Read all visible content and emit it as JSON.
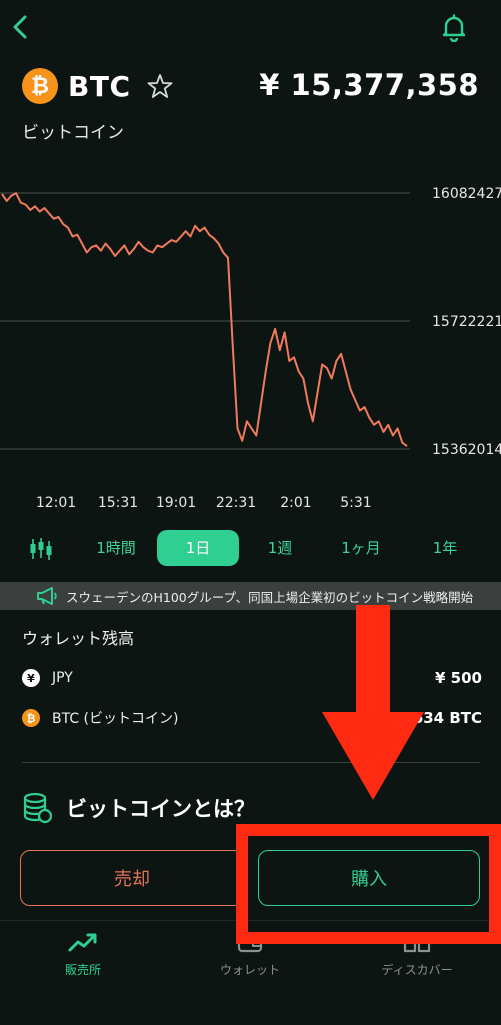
{
  "header": {
    "back_icon": "chevron-left-icon",
    "bell_icon": "bell-icon"
  },
  "coin": {
    "symbol": "BTC",
    "name": "ビットコイン",
    "price": "¥ 15,377,358",
    "logo_glyph": "₿"
  },
  "chart_data": {
    "type": "line",
    "y_ticks": [
      "16082427",
      "15722221",
      "15362014"
    ],
    "ylim": [
      15362014,
      16082427
    ],
    "x_ticks": [
      "12:01",
      "15:31",
      "19:01",
      "22:31",
      "2:01",
      "5:31"
    ],
    "line_color": "#f07a5c",
    "series": [
      {
        "values": [
          16080000,
          16060000,
          16075000,
          16082000,
          16055000,
          16050000,
          16035000,
          16045000,
          16030000,
          16040000,
          16025000,
          16010000,
          16015000,
          15995000,
          15985000,
          15960000,
          15965000,
          15940000,
          15915000,
          15930000,
          15935000,
          15920000,
          15940000,
          15925000,
          15905000,
          15920000,
          15935000,
          15910000,
          15925000,
          15945000,
          15930000,
          15920000,
          15915000,
          15935000,
          15930000,
          15940000,
          15950000,
          15945000,
          15960000,
          15975000,
          15960000,
          15990000,
          15975000,
          15985000,
          15965000,
          15955000,
          15940000,
          15915000,
          15900000,
          15650000,
          15420000,
          15385000,
          15440000,
          15420000,
          15400000,
          15490000,
          15580000,
          15660000,
          15700000,
          15640000,
          15690000,
          15610000,
          15620000,
          15580000,
          15560000,
          15490000,
          15440000,
          15520000,
          15600000,
          15590000,
          15560000,
          15610000,
          15630000,
          15580000,
          15530000,
          15500000,
          15470000,
          15480000,
          15450000,
          15430000,
          15440000,
          15410000,
          15430000,
          15400000,
          15420000,
          15380000,
          15370000
        ]
      }
    ],
    "grid": true
  },
  "ranges": {
    "candle_icon": "candlestick-icon",
    "items": [
      "1時間",
      "1日",
      "1週",
      "1ヶ月",
      "1年"
    ],
    "active": "1日"
  },
  "news": {
    "icon": "megaphone-icon",
    "text": "スウェーデンのH100グループ、同国上場企業初のビットコイン戦略開始"
  },
  "wallet": {
    "title": "ウォレット残高",
    "rows": [
      {
        "icon_glyph": "¥",
        "label": "JPY",
        "value": "¥ 500"
      },
      {
        "icon_glyph": "₿",
        "label": "BTC (ビットコイン)",
        "value": "634 BTC"
      }
    ]
  },
  "about": {
    "icon": "database-icon",
    "label": "ビットコインとは？"
  },
  "actions": {
    "sell": "売却",
    "buy": "購入"
  },
  "tabbar": [
    {
      "label": "販売所",
      "icon": "trend-up-icon",
      "active": true
    },
    {
      "label": "ウォレット",
      "icon": "wallet-icon",
      "active": false
    },
    {
      "label": "ディスカバー",
      "icon": "book-icon",
      "active": false
    }
  ],
  "colors": {
    "accent": "#2fcf92",
    "sell": "#e5755a",
    "annotation": "#ff2a12"
  }
}
